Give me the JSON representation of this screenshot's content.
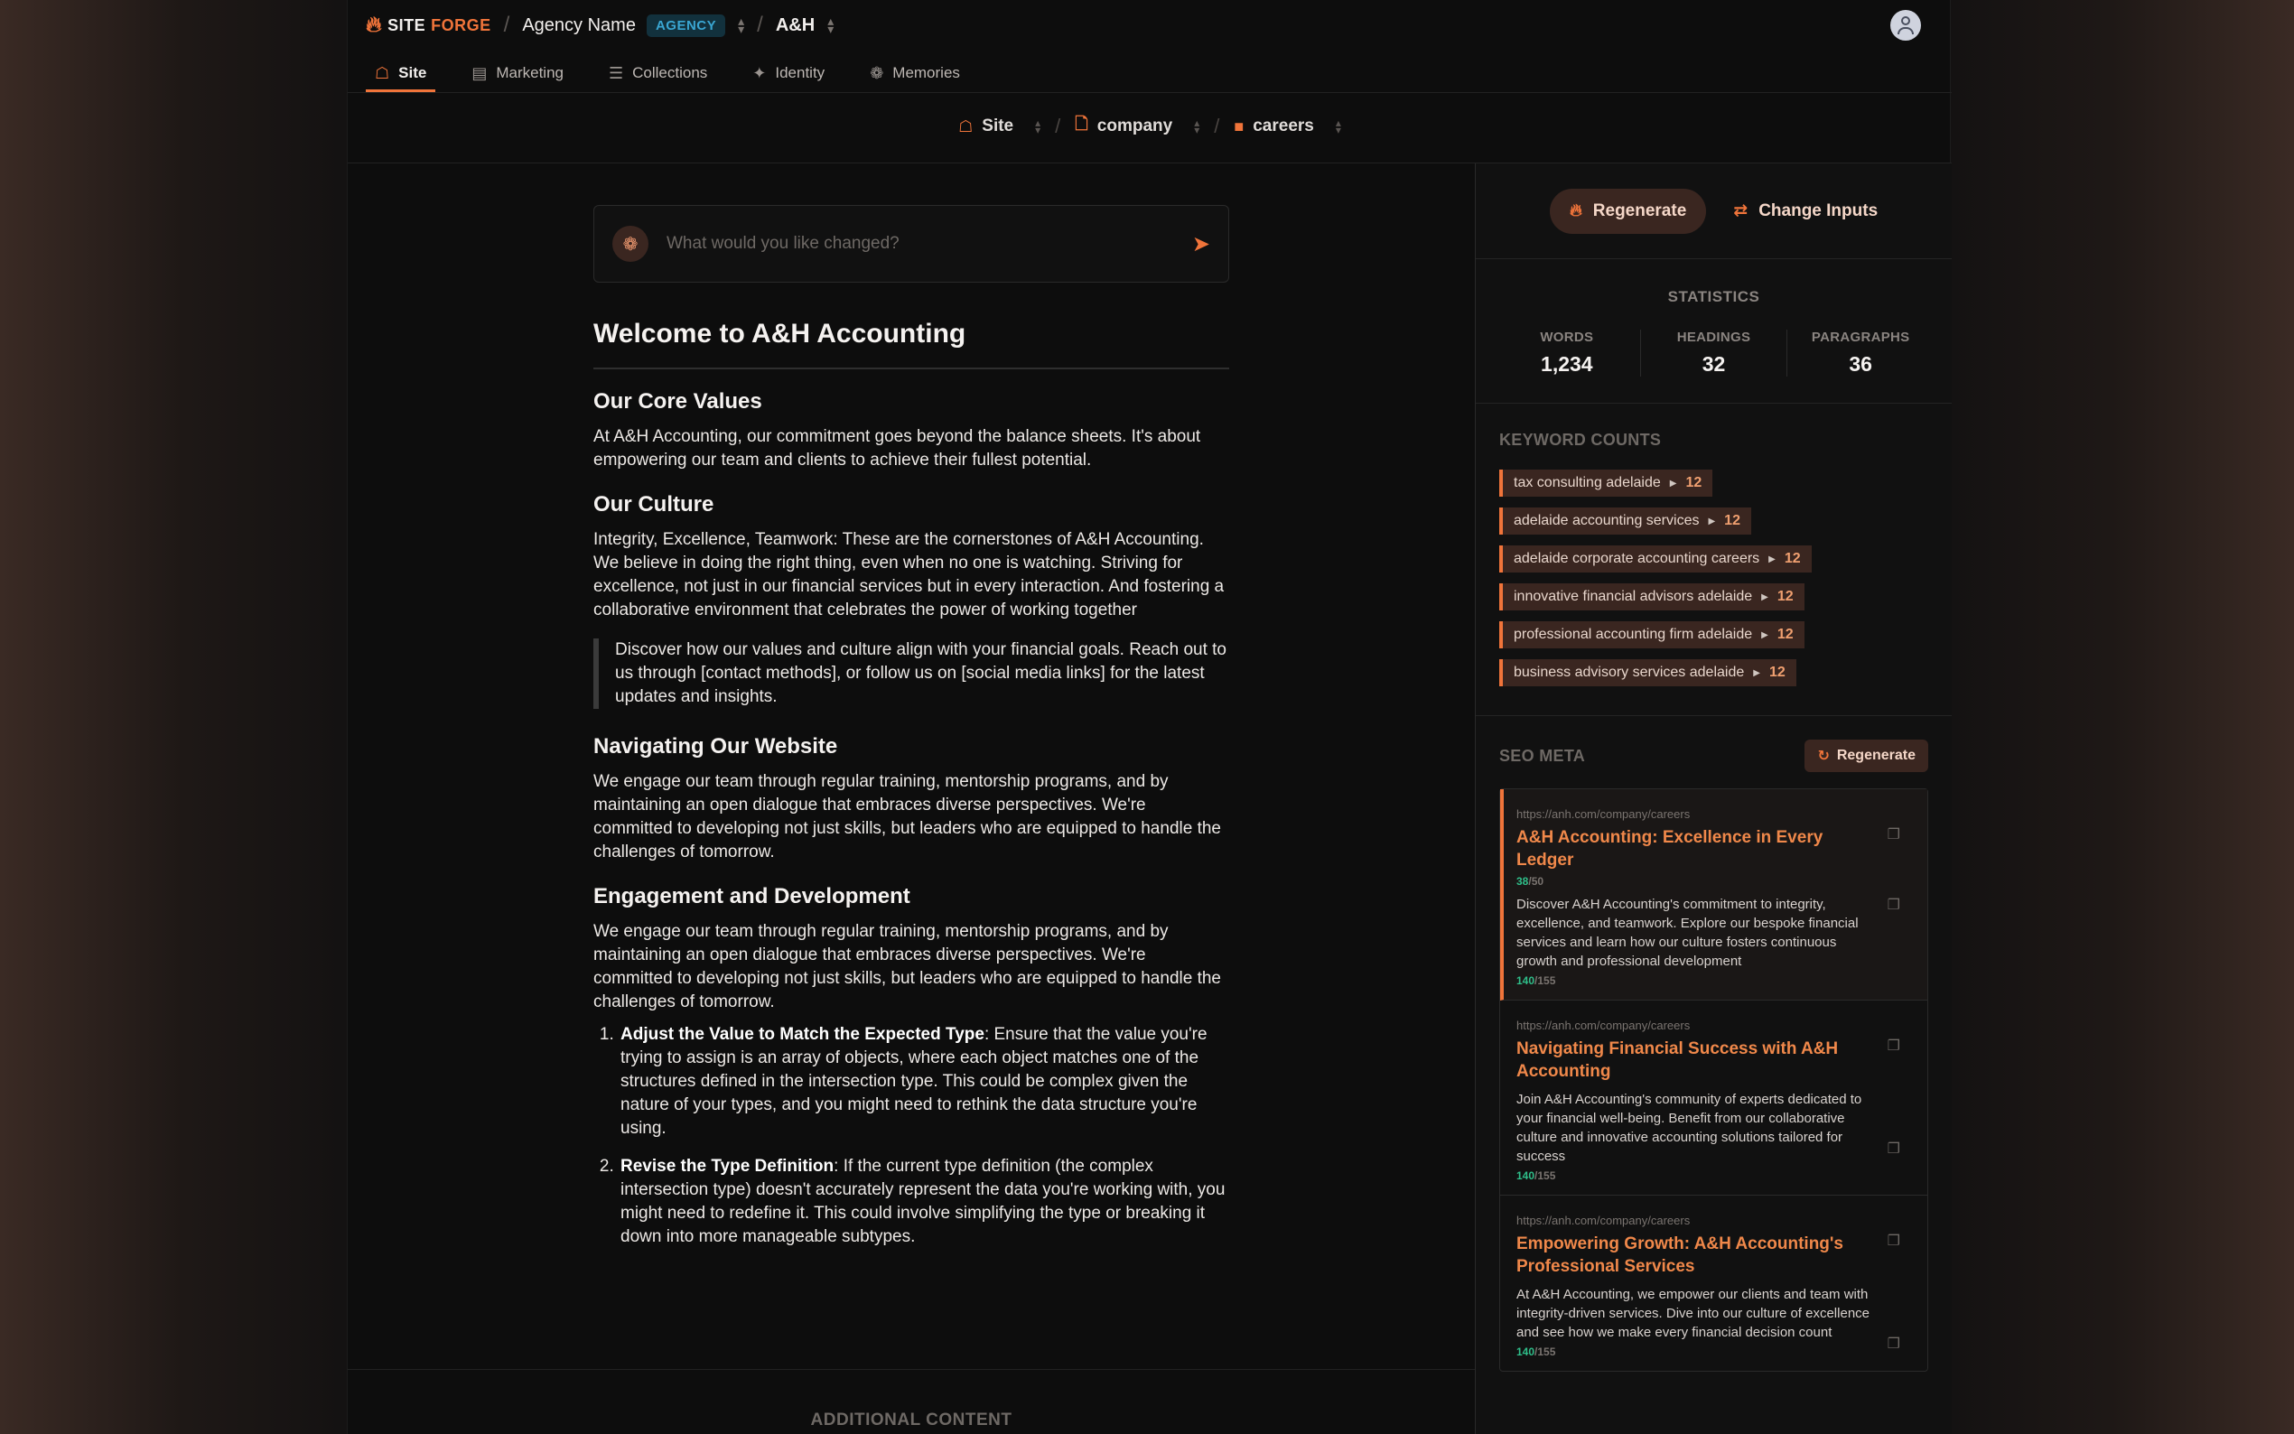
{
  "app": {
    "brand_site": "SITE",
    "brand_forge": "FORGE",
    "agency_name": "Agency Name",
    "agency_badge": "AGENCY",
    "project": "A&H"
  },
  "nav": {
    "tabs": [
      {
        "label": "Site",
        "icon": "sitemap-icon",
        "active": true
      },
      {
        "label": "Marketing",
        "icon": "newspaper-icon"
      },
      {
        "label": "Collections",
        "icon": "list-icon"
      },
      {
        "label": "Identity",
        "icon": "sparkles-icon"
      },
      {
        "label": "Memories",
        "icon": "brain-icon"
      }
    ]
  },
  "page_breadcrumb": {
    "items": [
      {
        "label": "Site",
        "icon": "sitemap-icon"
      },
      {
        "label": "company",
        "icon": "file-icon"
      },
      {
        "label": "careers",
        "icon": "file-filled-icon"
      }
    ]
  },
  "prompt": {
    "placeholder": "What would you like changed?"
  },
  "document": {
    "title": "Welcome to A&H Accounting",
    "sections": [
      {
        "heading": "Our Core Values",
        "text": "At A&H Accounting, our commitment goes beyond the balance sheets. It's about empowering our team and clients to achieve their fullest potential."
      },
      {
        "heading": "Our Culture",
        "text": "Integrity, Excellence, Teamwork: These are the cornerstones of A&H Accounting. We believe in doing the right thing, even when no one is watching. Striving for excellence, not just in our financial services but in every interaction. And fostering a collaborative environment that celebrates the power of working together"
      },
      {
        "quote": "Discover how our values and culture align with your financial goals. Reach out to us through [contact methods], or follow us on [social media links] for the latest updates and insights."
      },
      {
        "heading": "Navigating Our Website",
        "text": "We engage our team through regular training, mentorship programs, and by maintaining an open dialogue that embraces diverse perspectives. We're committed to developing not just skills, but leaders who are equipped to handle the challenges of tomorrow."
      },
      {
        "heading": "Engagement and Development",
        "text": "We engage our team through regular training, mentorship programs, and by maintaining an open dialogue that embraces diverse perspectives. We're committed to developing not just skills, but leaders who are equipped to handle the challenges of tomorrow."
      }
    ],
    "list": [
      {
        "bold": "Adjust the Value to Match the Expected Type",
        "text": ": Ensure that the value you're trying to assign is an array of objects, where each object matches one of the structures defined in the intersection type. This could be complex given the nature of your types, and you might need to rethink the data structure you're using."
      },
      {
        "bold": "Revise the Type Definition",
        "text": ": If the current type definition (the complex intersection type) doesn't accurately represent the data you're working with, you might need to redefine it. This could involve simplifying the type or breaking it down into more manageable subtypes."
      }
    ],
    "additional_content_label": "ADDITIONAL CONTENT"
  },
  "panel": {
    "regenerate_label": "Regenerate",
    "change_inputs_label": "Change Inputs",
    "statistics": {
      "title": "STATISTICS",
      "items": [
        {
          "label": "WORDS",
          "value": "1,234"
        },
        {
          "label": "HEADINGS",
          "value": "32"
        },
        {
          "label": "PARAGRAPHS",
          "value": "36"
        }
      ]
    },
    "keywords": {
      "title": "KEYWORD COUNTS",
      "items": [
        {
          "term": "tax consulting adelaide",
          "count": "12"
        },
        {
          "term": "adelaide accounting services",
          "count": "12"
        },
        {
          "term": "adelaide corporate accounting careers",
          "count": "12"
        },
        {
          "term": "innovative financial advisors adelaide",
          "count": "12"
        },
        {
          "term": "professional accounting firm adelaide",
          "count": "12"
        },
        {
          "term": "business advisory services adelaide",
          "count": "12"
        }
      ]
    },
    "seo": {
      "title": "SEO META",
      "regenerate_label": "Regenerate",
      "items": [
        {
          "url": "https://anh.com/company/careers",
          "title": "A&H Accounting: Excellence in Every Ledger",
          "title_count": "38",
          "title_max": "/50",
          "description": "Discover A&H Accounting's commitment to integrity, excellence, and teamwork. Explore our bespoke financial services and learn how our culture fosters continuous growth and professional development",
          "desc_count": "140",
          "desc_max": "/155",
          "active": true
        },
        {
          "url": "https://anh.com/company/careers",
          "title": "Navigating Financial Success with A&H Accounting",
          "description": "Join A&H Accounting's community of experts dedicated to your financial well-being. Benefit from our collaborative culture and innovative accounting solutions tailored for success",
          "desc_count": "140",
          "desc_max": "/155"
        },
        {
          "url": "https://anh.com/company/careers",
          "title": "Empowering Growth: A&H Accounting's Professional Services",
          "description": "At A&H Accounting, we empower our clients and team with integrity-driven services. Dive into our culture of excellence and see how we make every financial decision count",
          "desc_count": "140",
          "desc_max": "/155"
        }
      ]
    }
  },
  "colors": {
    "accent": "#f0743a",
    "badge_bg": "#12313d",
    "badge_text": "#3aa6d2",
    "count_ok": "#2fbf8a"
  }
}
